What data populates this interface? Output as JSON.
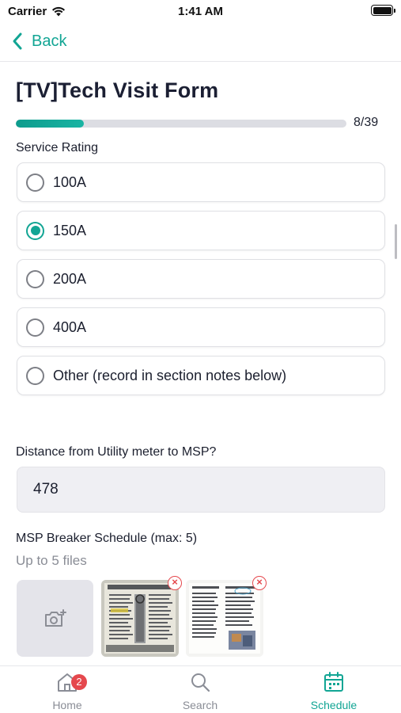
{
  "status_bar": {
    "carrier": "Carrier",
    "time": "1:41 AM"
  },
  "nav": {
    "back_label": "Back"
  },
  "form": {
    "title": "[TV]Tech Visit Form",
    "progress": {
      "current": 8,
      "total": 39,
      "label": "8/39"
    }
  },
  "service_rating": {
    "label": "Service Rating",
    "options": [
      {
        "label": "100A",
        "selected": false
      },
      {
        "label": "150A",
        "selected": true
      },
      {
        "label": "200A",
        "selected": false
      },
      {
        "label": "400A",
        "selected": false
      },
      {
        "label": "Other (record in section notes below)",
        "selected": false
      }
    ]
  },
  "distance": {
    "label": "Distance from Utility meter to MSP?",
    "value": "478"
  },
  "breaker_schedule": {
    "label": "MSP Breaker Schedule (max: 5)",
    "sublabel": "Up to 5 files",
    "remove_glyph": "×"
  },
  "tabs": [
    {
      "label": "Home",
      "icon": "home-icon",
      "badge": "2",
      "active": false
    },
    {
      "label": "Search",
      "icon": "search-icon",
      "active": false
    },
    {
      "label": "Schedule",
      "icon": "calendar-icon",
      "active": true
    }
  ],
  "colors": {
    "accent": "#12a594",
    "badge": "#e5484d",
    "text": "#1b1f2e",
    "muted": "#8a8d96"
  }
}
